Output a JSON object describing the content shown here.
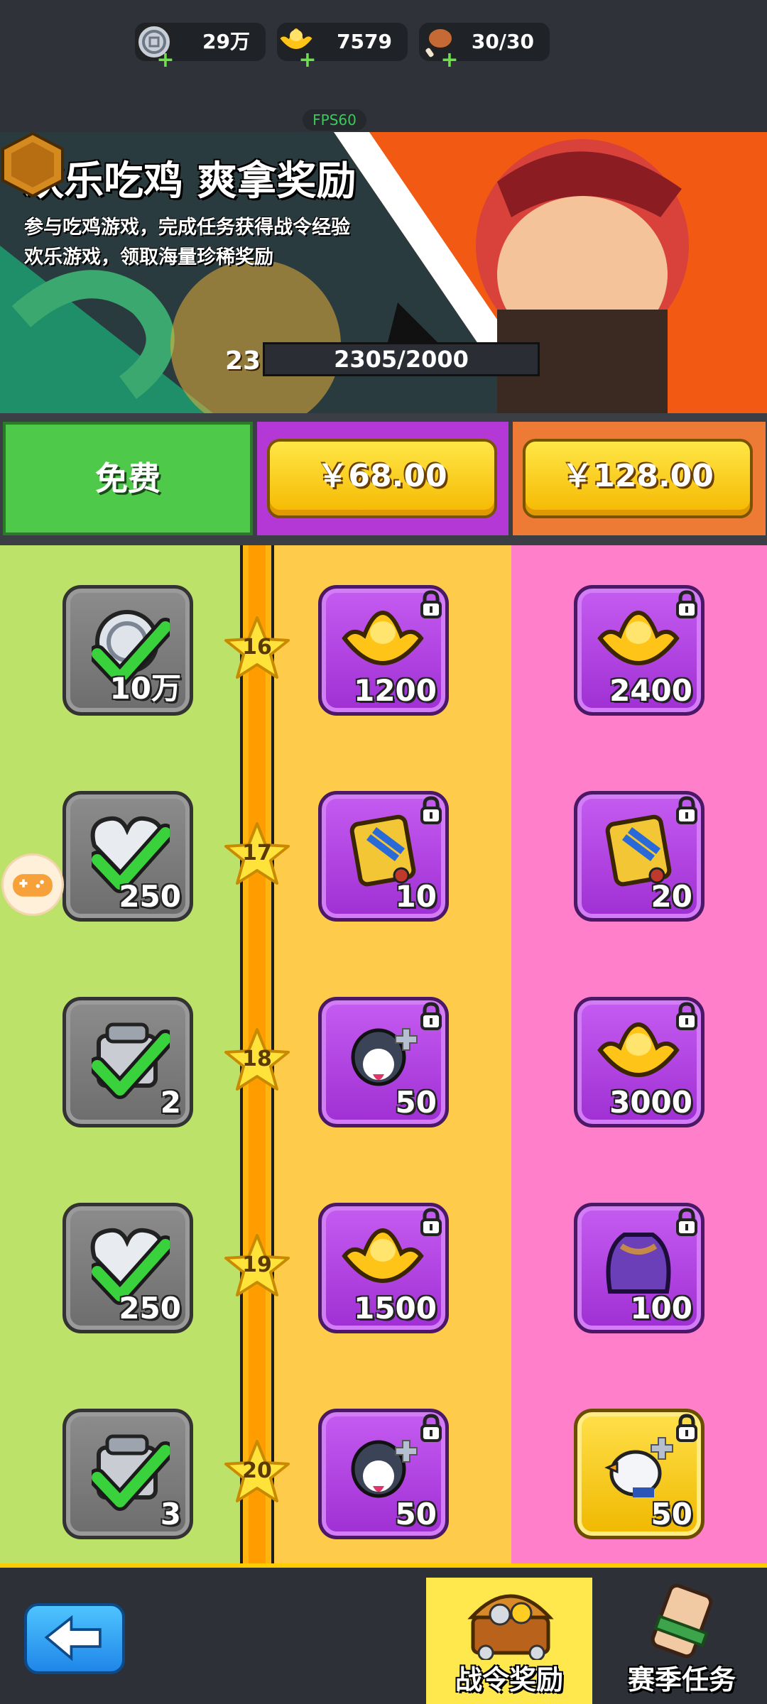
{
  "resources": [
    {
      "icon": "silver-coin-icon",
      "value": "29万"
    },
    {
      "icon": "gold-ingot-icon",
      "value": "7579"
    },
    {
      "icon": "meat-drumstick-icon",
      "value": "30/30"
    }
  ],
  "fps_label": "FPS60",
  "banner": {
    "title": "欢乐吃鸡 爽拿奖励",
    "line1": "参与吃鸡游戏，完成任务获得战令经验",
    "line2": "欢乐游戏，领取海量珍稀奖励",
    "level": "23",
    "xp_text": "2305/2000"
  },
  "tiers": {
    "free_label": "免费",
    "tier1_price": "￥68.00",
    "tier2_price": "￥128.00"
  },
  "rows": [
    {
      "level": "16",
      "free": {
        "icon": "silver-coin-icon",
        "qty": "10万",
        "claimed": true
      },
      "tier1": {
        "icon": "gold-ingot-icon",
        "qty": "1200",
        "locked": true
      },
      "tier2": {
        "icon": "gold-ingot-icon",
        "qty": "2400",
        "locked": true
      }
    },
    {
      "level": "17",
      "free": {
        "icon": "heart-icon",
        "qty": "250",
        "claimed": true
      },
      "tier1": {
        "icon": "scroll-token-icon",
        "qty": "10",
        "locked": true
      },
      "tier2": {
        "icon": "scroll-token-icon",
        "qty": "20",
        "locked": true
      }
    },
    {
      "level": "18",
      "free": {
        "icon": "ore-chest-icon",
        "qty": "2",
        "claimed": true
      },
      "tier1": {
        "icon": "husky-fragment-icon",
        "qty": "50",
        "locked": true
      },
      "tier2": {
        "icon": "gold-ingot-icon",
        "qty": "3000",
        "locked": true
      }
    },
    {
      "level": "19",
      "free": {
        "icon": "heart-icon",
        "qty": "250",
        "claimed": true
      },
      "tier1": {
        "icon": "gold-ingot-icon",
        "qty": "1500",
        "locked": true
      },
      "tier2": {
        "icon": "purple-bag-icon",
        "qty": "100",
        "locked": true
      }
    },
    {
      "level": "20",
      "free": {
        "icon": "ore-chest-icon",
        "qty": "3",
        "claimed": true
      },
      "tier1": {
        "icon": "husky-fragment-icon",
        "qty": "50",
        "locked": true
      },
      "tier2": {
        "icon": "goose-fragment-icon",
        "qty": "50",
        "locked": true,
        "gold_frame": true
      }
    }
  ],
  "nav": {
    "tab_rewards": "战令奖励",
    "tab_tasks": "赛季任务"
  },
  "colors": {
    "free_col": "#bde26a",
    "tier1_col": "#ffcb4a",
    "tier2_col": "#ff7fcb",
    "accent_gold": "#ffcc00"
  }
}
